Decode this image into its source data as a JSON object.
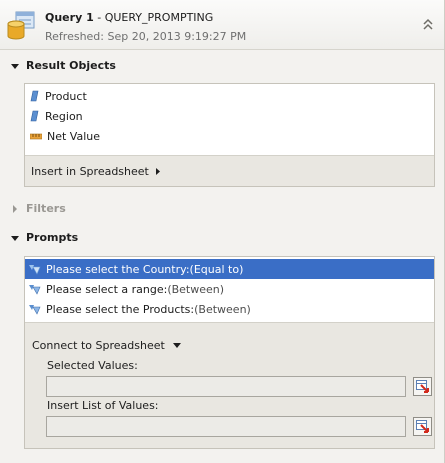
{
  "header": {
    "query_name": "Query 1",
    "query_sep": " - ",
    "query_id": "QUERY_PROMPTING",
    "refreshed": "Refreshed: Sep 20, 2013 9:19:27 PM"
  },
  "result_objects": {
    "title": "Result Objects",
    "items": [
      {
        "label": "Product",
        "icon": "dimension-icon"
      },
      {
        "label": "Region",
        "icon": "dimension-icon"
      },
      {
        "label": "Net Value",
        "icon": "measure-icon"
      }
    ],
    "insert_label": "Insert in Spreadsheet"
  },
  "filters": {
    "title": "Filters"
  },
  "prompts": {
    "title": "Prompts",
    "items": [
      {
        "label": "Please select the Country:",
        "qualifier": " (Equal to)",
        "selected": true
      },
      {
        "label": "Please select a range:",
        "qualifier": " (Between)",
        "selected": false
      },
      {
        "label": "Please select the Products:",
        "qualifier": " (Between)",
        "selected": false
      }
    ],
    "connect_label": "Connect to Spreadsheet",
    "selected_values_label": "Selected Values:",
    "selected_values_value": "",
    "insert_lov_label": "Insert List of Values:",
    "insert_lov_value": ""
  },
  "colors": {
    "selection": "#3a6ec6",
    "background": "#f3f2ef"
  }
}
